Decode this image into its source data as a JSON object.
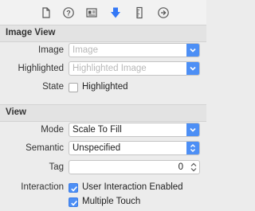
{
  "toolbar": {
    "icons": [
      "file-icon",
      "help-icon",
      "identity-icon",
      "attributes-icon",
      "size-icon",
      "connections-icon"
    ],
    "accent": "#3478f6"
  },
  "image_view": {
    "title": "Image View",
    "image_label": "Image",
    "image_placeholder": "Image",
    "highlighted_label": "Highlighted",
    "highlighted_placeholder": "Highlighted Image",
    "state_label": "State",
    "state_checkbox_label": "Highlighted",
    "state_checked": false
  },
  "view": {
    "title": "View",
    "mode_label": "Mode",
    "mode_value": "Scale To Fill",
    "semantic_label": "Semantic",
    "semantic_value": "Unspecified",
    "tag_label": "Tag",
    "tag_value": "0",
    "interaction_label": "Interaction",
    "user_interaction_label": "User Interaction Enabled",
    "user_interaction_checked": true,
    "multiple_touch_label": "Multiple Touch",
    "multiple_touch_checked": true
  }
}
